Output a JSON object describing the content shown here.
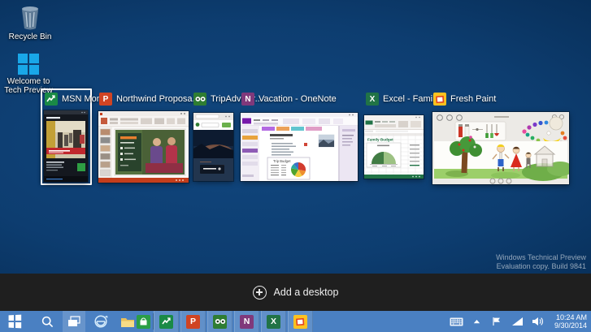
{
  "desktop": {
    "icons": [
      {
        "label": "Recycle Bin"
      },
      {
        "label": "Welcome to Tech Preview"
      }
    ],
    "watermark_line1": "Windows Technical Preview",
    "watermark_line2": "Evaluation copy. Build 9841"
  },
  "task_view": {
    "add_desktop_label": "Add a desktop",
    "windows": [
      {
        "title": "MSN Mon...",
        "app": "MSN Money",
        "selected": true
      },
      {
        "title": "Northwind Proposa...",
        "app": "PowerPoint",
        "selected": false
      },
      {
        "title": "TripAdvisor...",
        "app": "TripAdvisor",
        "selected": false
      },
      {
        "title": "Vacation - OneNote",
        "app": "OneNote",
        "selected": false
      },
      {
        "title": "Excel - Family...",
        "app": "Excel",
        "selected": false
      },
      {
        "title": "Fresh Paint",
        "app": "Fresh Paint",
        "selected": false
      }
    ],
    "thumbnail_texts": {
      "onenote_budget_title": "Trip Budget",
      "excel_sheet_title": "Family Budget"
    }
  },
  "taskbar": {
    "buttons": [
      "start",
      "search",
      "task-view",
      "internet-explorer",
      "file-explorer",
      "store"
    ],
    "running_apps": [
      "msn-money",
      "powerpoint",
      "tripadvisor",
      "onenote",
      "excel",
      "fresh-paint"
    ],
    "tray_icons": [
      "touch-keyboard",
      "show-hidden",
      "action-center-flag",
      "network",
      "volume"
    ],
    "tray": {
      "time": "10:24 AM",
      "date": "9/30/2014"
    }
  },
  "colors": {
    "taskbar": "#4a80c2",
    "add_bar": "#1f1f1f",
    "selection": "#ffffff",
    "msn_green": "#1a8a46",
    "powerpoint_orange": "#d04423",
    "tripadvisor_green": "#2f7d32",
    "onenote_purple": "#80397b",
    "excel_green": "#217346",
    "freshpaint_yellow": "#fdc21f"
  }
}
